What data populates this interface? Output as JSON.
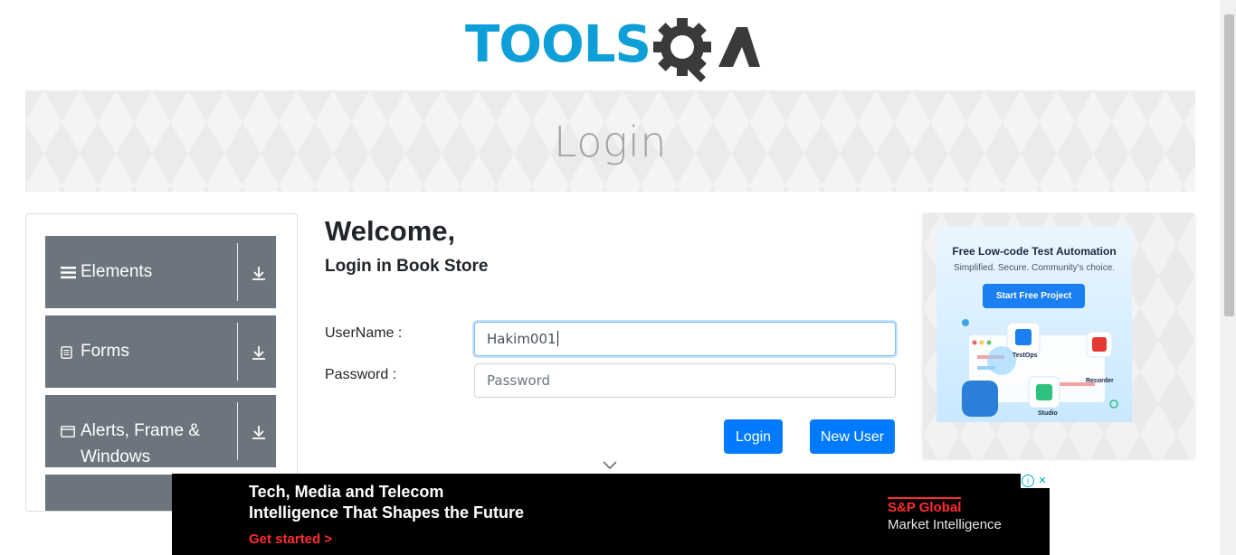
{
  "header": {
    "logo_text_left": "TOOLS",
    "logo_text_right": "QA"
  },
  "banner": {
    "title": "Login"
  },
  "sidebar": {
    "groups": [
      {
        "label": "Elements",
        "icon": "hamburger-icon"
      },
      {
        "label": "Forms",
        "icon": "form-icon"
      },
      {
        "label": "Alerts, Frame &",
        "label2": "Windows",
        "icon": "window-icon"
      }
    ]
  },
  "form": {
    "welcome": "Welcome,",
    "subtitle": "Login in Book Store",
    "username_label": "UserName :",
    "username_value": "Hakim001",
    "password_label": "Password :",
    "password_placeholder": "Password",
    "login_button": "Login",
    "new_user_button": "New User"
  },
  "side_ad": {
    "title": "Free Low-code Test Automation",
    "subtitle": "Simplified. Secure. Community's choice.",
    "button": "Start Free Project",
    "tags": [
      "TestOps",
      "Recorder",
      "Studio"
    ]
  },
  "bottom_ad": {
    "line1": "Tech, Media and Telecom",
    "line2": "Intelligence That Shapes the Future",
    "cta": "Get started >",
    "brand1": "S&P Global",
    "brand2": "Market Intelligence"
  },
  "colors": {
    "primary": "#007bff",
    "sidebar": "#6c757d",
    "logo_blue": "#0e9fd9",
    "logo_dark": "#3a3a3a"
  }
}
